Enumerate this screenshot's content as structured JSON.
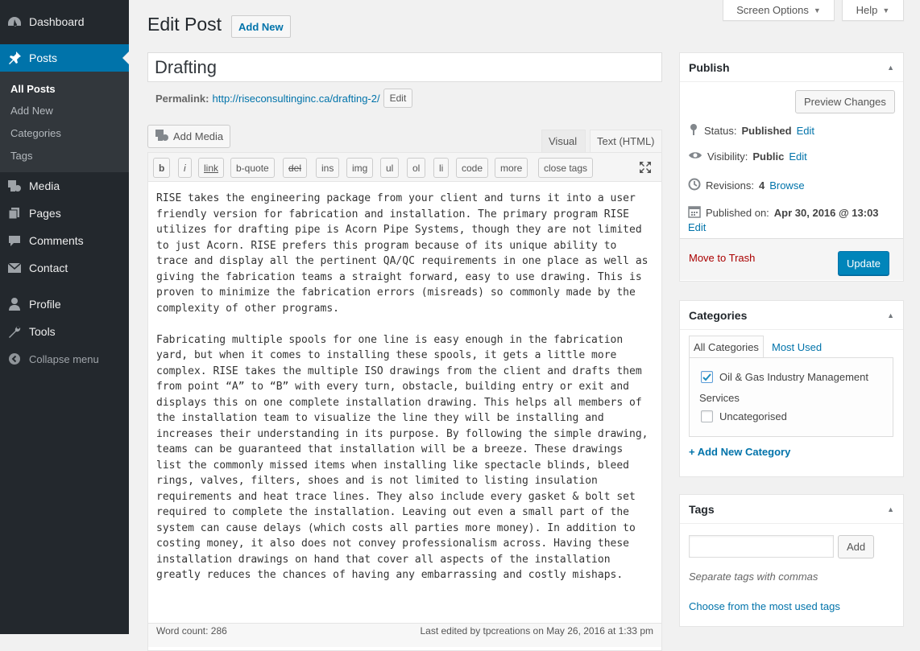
{
  "sidebar": {
    "dashboard": "Dashboard",
    "posts": "Posts",
    "sub": [
      "All Posts",
      "Add New",
      "Categories",
      "Tags"
    ],
    "media": "Media",
    "pages": "Pages",
    "comments": "Comments",
    "contact": "Contact",
    "profile": "Profile",
    "tools": "Tools",
    "collapse": "Collapse menu"
  },
  "top": {
    "screen_options": "Screen Options",
    "help": "Help"
  },
  "header": {
    "title": "Edit Post",
    "add_new": "Add New"
  },
  "post": {
    "title": "Drafting",
    "permalink_label": "Permalink:",
    "permalink_url": "http://riseconsultinginc.ca/drafting-2/",
    "permalink_edit": "Edit"
  },
  "editor": {
    "add_media": "Add Media",
    "tab_visual": "Visual",
    "tab_text": "Text (HTML)",
    "quicktags": [
      "b",
      "i",
      "link",
      "b-quote",
      "del",
      "ins",
      "img",
      "ul",
      "ol",
      "li",
      "code",
      "more",
      "close tags"
    ],
    "content": "RISE takes the engineering package from your client and turns it into a user\nfriendly version for fabrication and installation. The primary program RISE\nutilizes for drafting pipe is Acorn Pipe Systems, though they are not limited\nto just Acorn. RISE prefers this program because of its unique ability to\ntrace and display all the pertinent QA/QC requirements in one place as well as\ngiving the fabrication teams a straight forward, easy to use drawing. This is\nproven to minimize the fabrication errors (misreads) so commonly made by the\ncomplexity of other programs.\n\nFabricating multiple spools for one line is easy enough in the fabrication\nyard, but when it comes to installing these spools, it gets a little more\ncomplex. RISE takes the multiple ISO drawings from the client and drafts them\nfrom point “A” to “B” with every turn, obstacle, building entry or exit and\ndisplays this on one complete installation drawing. This helps all members of\nthe installation team to visualize the line they will be installing and\nincreases their understanding in its purpose. By following the simple drawing,\nteams can be guaranteed that installation will be a breeze. These drawings\nlist the commonly missed items when installing like spectacle blinds, bleed\nrings, valves, filters, shoes and is not limited to listing insulation\nrequirements and heat trace lines. They also include every gasket & bolt set\nrequired to complete the installation. Leaving out even a small part of the\nsystem can cause delays (which costs all parties more money). In addition to\ncosting money, it also does not convey professionalism across. Having these\ninstallation drawings on hand that cover all aspects of the installation\ngreatly reduces the chances of having any embarrassing and costly mishaps.",
    "word_count": "Word count: 286",
    "last_edited": "Last edited by tpcreations on May 26, 2016 at 1:33 pm"
  },
  "publish": {
    "heading": "Publish",
    "preview": "Preview Changes",
    "status_label": "Status:",
    "status_value": "Published",
    "visibility_label": "Visibility:",
    "visibility_value": "Public",
    "revisions_label": "Revisions:",
    "revisions_value": "4",
    "browse": "Browse",
    "published_label": "Published on:",
    "published_value": "Apr 30, 2016 @ 13:03",
    "edit": "Edit",
    "trash": "Move to Trash",
    "update": "Update"
  },
  "categories": {
    "heading": "Categories",
    "tab_all": "All Categories",
    "tab_used": "Most Used",
    "items": [
      {
        "label": "Oil & Gas Industry Management",
        "label2": "Services",
        "checked": true
      },
      {
        "label": "Uncategorised",
        "checked": false
      }
    ],
    "add_new": "+ Add New Category"
  },
  "tags": {
    "heading": "Tags",
    "input_value": "",
    "add": "Add",
    "hint": "Separate tags with commas",
    "choose": "Choose from the most used tags"
  },
  "colors": {
    "menu_bg": "#23282d",
    "submenu_bg": "#32373c",
    "accent": "#0073aa",
    "update_btn": "#0085ba",
    "trash": "#aa0000"
  }
}
